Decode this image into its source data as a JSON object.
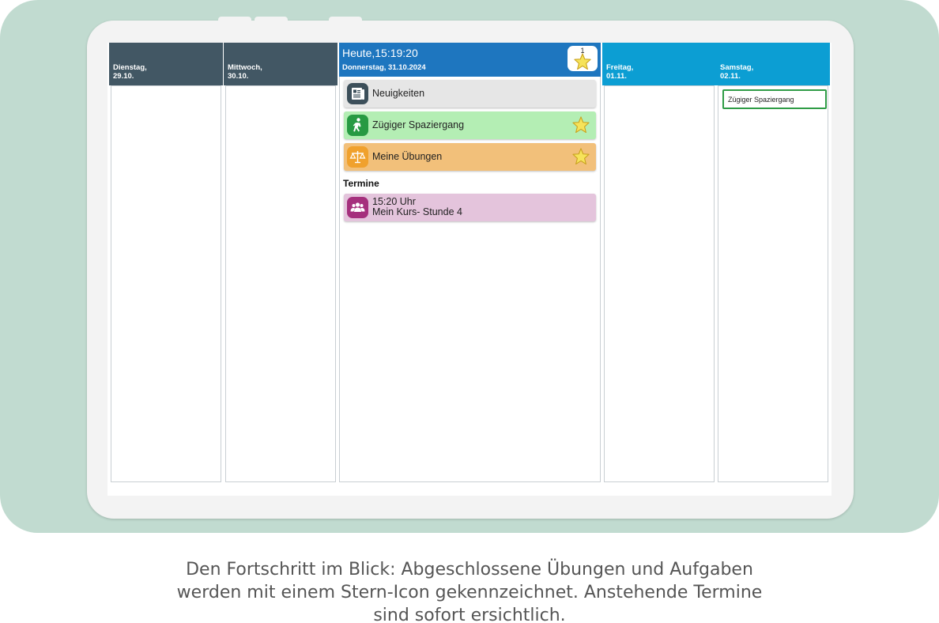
{
  "days": [
    {
      "name": "Dienstag,",
      "date": "29.10."
    },
    {
      "name": "Mittwoch,",
      "date": "30.10."
    },
    {
      "name": "Freitag,",
      "date": "01.11."
    },
    {
      "name": "Samstag,",
      "date": "02.11."
    }
  ],
  "today": {
    "time": "Heute,15:19:20",
    "date": "Donnerstag, 31.10.2024",
    "star_count": "1"
  },
  "tasks": [
    {
      "label": "Neuigkeiten",
      "icon": "newspaper-icon",
      "color": "#e6e6e6",
      "starred": false
    },
    {
      "label": "Zügiger Spaziergang",
      "icon": "walking-icon",
      "color": "#b4eeb4",
      "starred": true
    },
    {
      "label": "Meine Übungen",
      "icon": "scale-icon",
      "color": "#f2c07a",
      "starred": true
    }
  ],
  "appointments_heading": "Termine",
  "appointment": {
    "time": "15:20 Uhr",
    "title": "Mein Kurs- Stunde 4",
    "icon": "group-icon"
  },
  "saturday_task": "Zügiger Spaziergang",
  "caption": [
    "Den Fortschritt im Blick: Abgeschlossene Übungen und Aufgaben",
    "werden mit einem Stern-Icon gekennzeichnet. Anstehende Termine",
    "sind sofort ersichtlich."
  ],
  "colors": {
    "past_header": "#425764",
    "today_header": "#1e76bf",
    "future_header": "#0c9ed3",
    "background": "#c1dbd0"
  }
}
